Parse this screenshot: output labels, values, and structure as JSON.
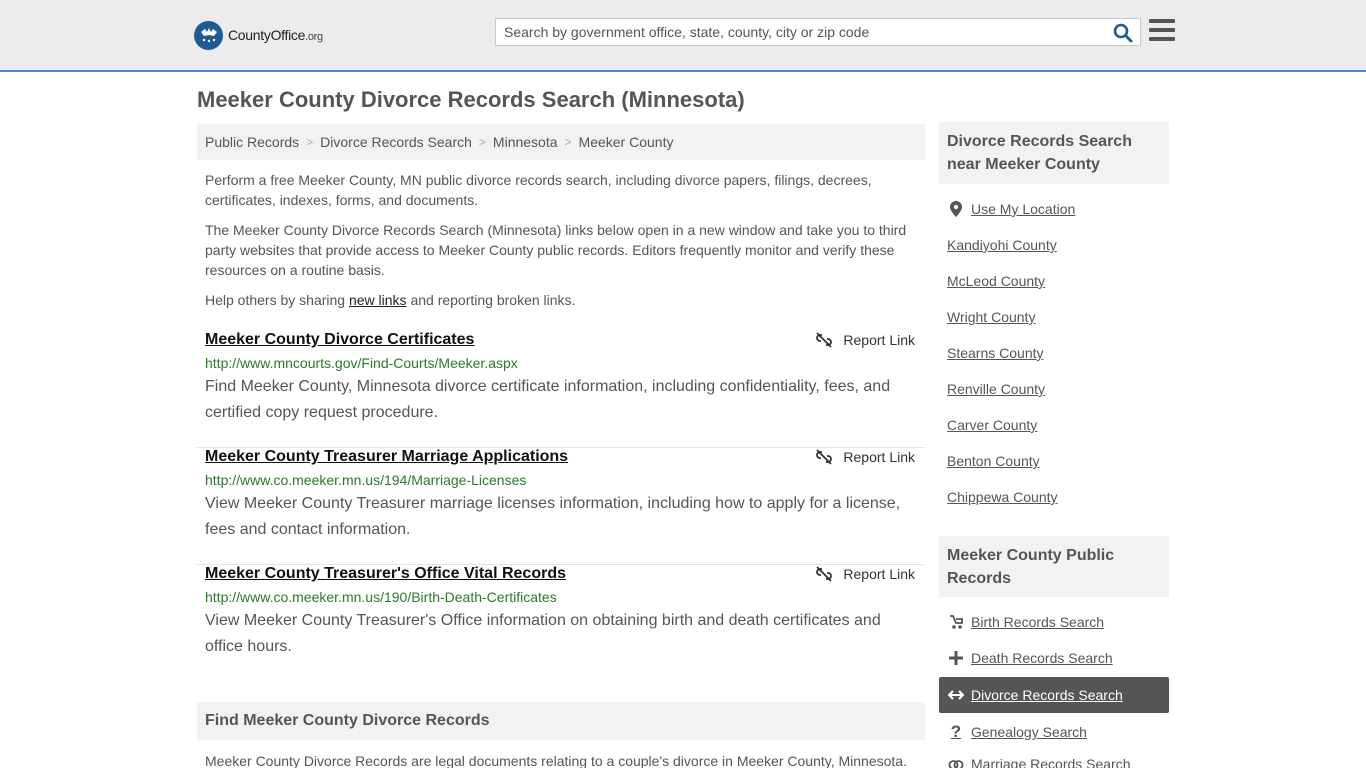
{
  "header": {
    "logo": {
      "county": "County",
      "office": "Office",
      "org": ".org"
    },
    "search_placeholder": "Search by government office, state, county, city or zip code"
  },
  "page": {
    "title": "Meeker County Divorce Records Search (Minnesota)",
    "breadcrumb": [
      "Public Records",
      "Divorce Records Search",
      "Minnesota",
      "Meeker County"
    ],
    "intro": {
      "p1": "Perform a free Meeker County, MN public divorce records search, including divorce papers, filings, decrees, certificates, indexes, forms, and documents.",
      "p2": "The Meeker County Divorce Records Search (Minnesota) links below open in a new window and take you to third party websites that provide access to Meeker County public records. Editors frequently monitor and verify these resources on a routine basis.",
      "p3_prefix": "Help others by sharing ",
      "p3_link": "new links",
      "p3_suffix": " and reporting broken links."
    },
    "report_label": "Report Link",
    "results": [
      {
        "title": "Meeker County Divorce Certificates",
        "url": "http://www.mncourts.gov/Find-Courts/Meeker.aspx",
        "desc": "Find Meeker County, Minnesota divorce certificate information, including confidentiality, fees, and certified copy request procedure."
      },
      {
        "title": "Meeker County Treasurer Marriage Applications",
        "url": "http://www.co.meeker.mn.us/194/Marriage-Licenses",
        "desc": "View Meeker County Treasurer marriage licenses information, including how to apply for a license, fees and contact information."
      },
      {
        "title": "Meeker County Treasurer's Office Vital Records",
        "url": "http://www.co.meeker.mn.us/190/Birth-Death-Certificates",
        "desc": "View Meeker County Treasurer's Office information on obtaining birth and death certificates and office hours."
      }
    ],
    "find_heading": "Find Meeker County Divorce Records",
    "find_text": "Meeker County Divorce Records are legal documents relating to a couple's divorce in Meeker County, Minnesota."
  },
  "sidebar": {
    "near_heading": "Divorce Records Search near Meeker County",
    "use_location": "Use My Location",
    "nearby": [
      "Kandiyohi County",
      "McLeod County",
      "Wright County",
      "Stearns County",
      "Renville County",
      "Carver County",
      "Benton County",
      "Chippewa County"
    ],
    "public_heading": "Meeker County Public Records",
    "public_links": [
      {
        "label": "Birth Records Search",
        "icon": "baby-carriage-icon"
      },
      {
        "label": "Death Records Search",
        "icon": "cross-icon"
      },
      {
        "label": "Divorce Records Search",
        "icon": "split-arrows-icon",
        "active": true
      },
      {
        "label": "Genealogy Search",
        "icon": "question-icon"
      },
      {
        "label": "Marriage Records Search",
        "icon": "rings-icon"
      }
    ]
  },
  "colors": {
    "header_bg": "#ececec",
    "header_border": "#4e88c7",
    "url_green": "#2a7a2a",
    "active_bg": "#555555",
    "logo_blue": "#1f5a96",
    "search_icon": "#1f5a96"
  }
}
